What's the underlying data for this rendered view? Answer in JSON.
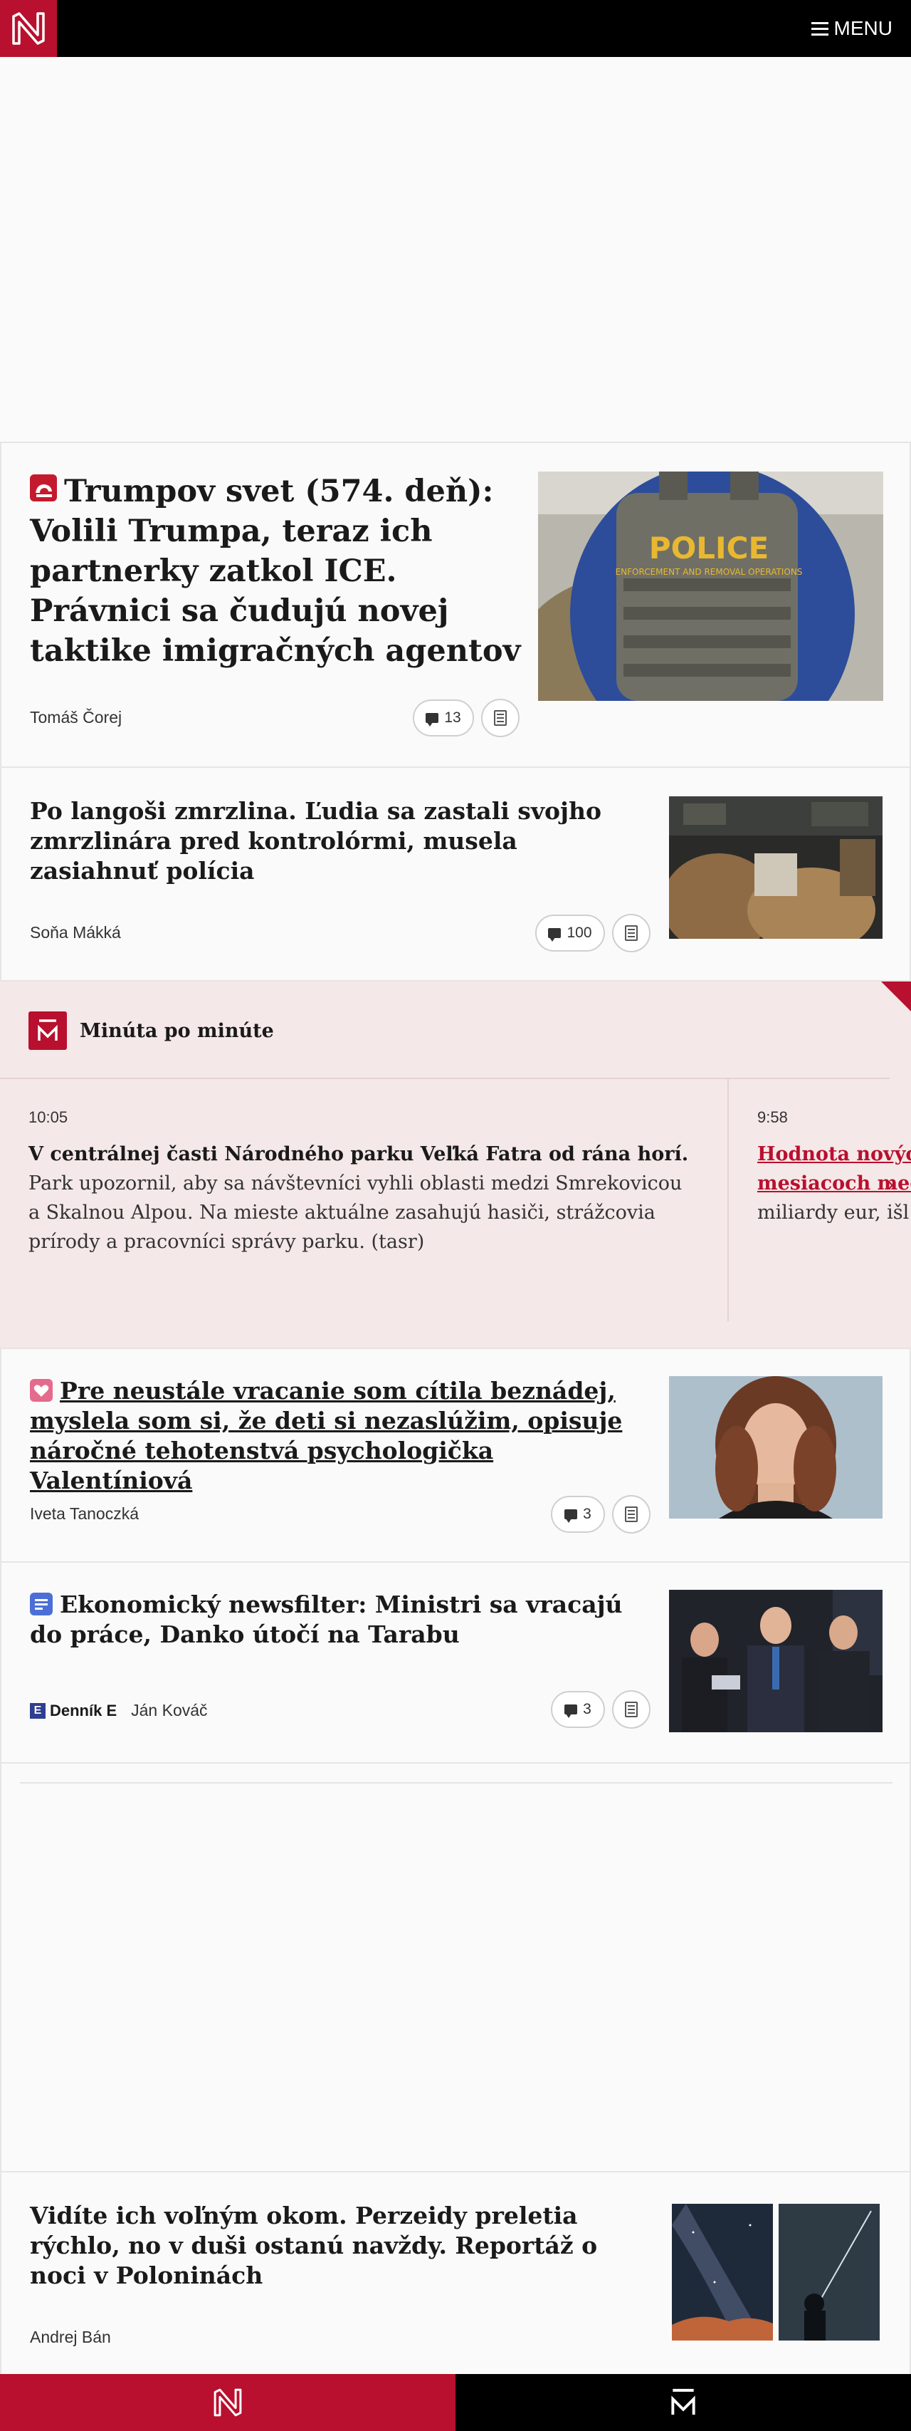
{
  "header": {
    "menu_label": "MENU"
  },
  "articles": [
    {
      "title": "Trumpov svet (574. deň): Volili Trumpa, teraz ich partnerky zatkol ICE. Právnici sa čudujú novej taktike imigračných agentov",
      "author": "Tomáš Čorej",
      "comments": "13",
      "image_text": "POLICE",
      "image_subtext": "ENFORCEMENT AND REMOVAL OPERATIONS"
    },
    {
      "title": "Po langoši zmrzlina. Ľudia sa zastali svojho zmrzlinára pred kontrolórmi, musela zasiahnuť polícia",
      "author": "Soňa Mákká",
      "comments": "100"
    },
    {
      "title": "Pre neustále vracanie som cítila beznádej, myslela som si, že deti si nezaslúžim, opisuje náročné tehotenstvá psychologička Valentíniová",
      "author": "Iveta Tanoczká",
      "comments": "3"
    },
    {
      "title": "Ekonomický newsfilter: Ministri sa vracajú do práce, Danko útočí na Tarabu",
      "author": "Ján Kováč",
      "source": "Denník E",
      "comments": "3"
    },
    {
      "title": "Vidíte ich voľným okom. Perzeidy preletia rýchlo, no v duši ostanú navždy. Reportáž o noci v Poloninách",
      "author": "Andrej Bán"
    }
  ],
  "live": {
    "title": "Minúta po minúte",
    "entries": [
      {
        "time": "10:05",
        "lead": "V centrálnej časti Národného parku Veľká Fatra od rána horí.",
        "body": " Park upozornil, aby sa návštevníci vyhli oblasti medzi Smrekovicou a Skalnou Alpou. Na mieste aktuálne zasahujú hasiči, strážcovia prírody a pracovníci správy parku. (tasr)"
      },
      {
        "time": "9:58",
        "link_line1": "Hodnota nových",
        "link_line2": "mesiacoch med",
        "body": "miliardy eur, išl"
      }
    ]
  },
  "colors": {
    "brand_red": "#b8102e",
    "black": "#000000",
    "live_bg": "#f5e8e8"
  }
}
